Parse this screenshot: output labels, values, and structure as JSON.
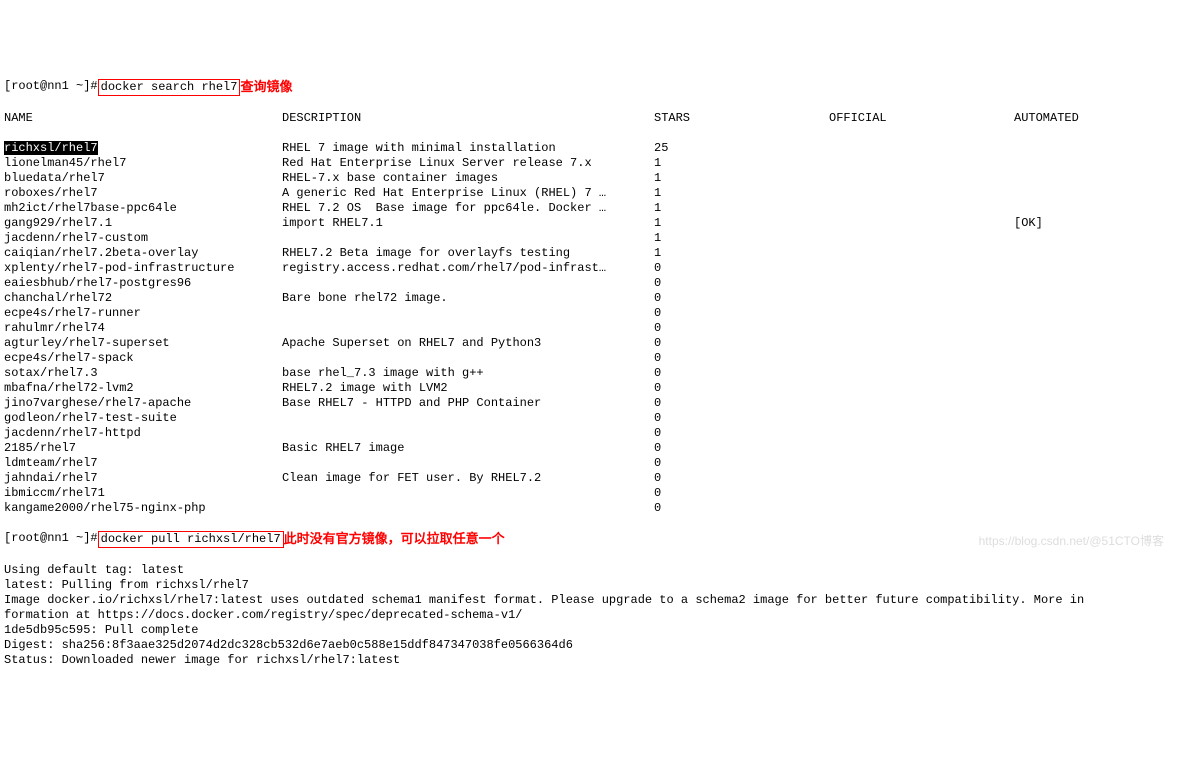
{
  "prompt1": "[root@nn1 ~]#",
  "command1": "docker search rhel7",
  "annotation1": "查询镜像",
  "headers": {
    "name": "NAME",
    "description": "DESCRIPTION",
    "stars": "STARS",
    "official": "OFFICIAL",
    "automated": "AUTOMATED"
  },
  "results": [
    {
      "name": "richxsl/rhel7",
      "desc": "RHEL 7 image with minimal installation",
      "stars": "25",
      "official": "",
      "auto": "",
      "highlight": true
    },
    {
      "name": "lionelman45/rhel7",
      "desc": "Red Hat Enterprise Linux Server release 7.x",
      "stars": "1",
      "official": "",
      "auto": ""
    },
    {
      "name": "bluedata/rhel7",
      "desc": "RHEL-7.x base container images",
      "stars": "1",
      "official": "",
      "auto": ""
    },
    {
      "name": "roboxes/rhel7",
      "desc": "A generic Red Hat Enterprise Linux (RHEL) 7 …",
      "stars": "1",
      "official": "",
      "auto": ""
    },
    {
      "name": "mh2ict/rhel7base-ppc64le",
      "desc": "RHEL 7.2 OS  Base image for ppc64le. Docker …",
      "stars": "1",
      "official": "",
      "auto": ""
    },
    {
      "name": "gang929/rhel7.1",
      "desc": "import RHEL7.1",
      "stars": "1",
      "official": "",
      "auto": "[OK]"
    },
    {
      "name": "jacdenn/rhel7-custom",
      "desc": "",
      "stars": "1",
      "official": "",
      "auto": ""
    },
    {
      "name": "caiqian/rhel7.2beta-overlay",
      "desc": "RHEL7.2 Beta image for overlayfs testing",
      "stars": "1",
      "official": "",
      "auto": ""
    },
    {
      "name": "xplenty/rhel7-pod-infrastructure",
      "desc": "registry.access.redhat.com/rhel7/pod-infrast…",
      "stars": "0",
      "official": "",
      "auto": ""
    },
    {
      "name": "eaiesbhub/rhel7-postgres96",
      "desc": "",
      "stars": "0",
      "official": "",
      "auto": ""
    },
    {
      "name": "chanchal/rhel72",
      "desc": "Bare bone rhel72 image.",
      "stars": "0",
      "official": "",
      "auto": ""
    },
    {
      "name": "ecpe4s/rhel7-runner",
      "desc": "",
      "stars": "0",
      "official": "",
      "auto": ""
    },
    {
      "name": "rahulmr/rhel74",
      "desc": "",
      "stars": "0",
      "official": "",
      "auto": ""
    },
    {
      "name": "agturley/rhel7-superset",
      "desc": "Apache Superset on RHEL7 and Python3",
      "stars": "0",
      "official": "",
      "auto": ""
    },
    {
      "name": "ecpe4s/rhel7-spack",
      "desc": "",
      "stars": "0",
      "official": "",
      "auto": ""
    },
    {
      "name": "sotax/rhel7.3",
      "desc": "base rhel_7.3 image with g++",
      "stars": "0",
      "official": "",
      "auto": ""
    },
    {
      "name": "mbafna/rhel72-lvm2",
      "desc": "RHEL7.2 image with LVM2",
      "stars": "0",
      "official": "",
      "auto": ""
    },
    {
      "name": "jino7varghese/rhel7-apache",
      "desc": "Base RHEL7 - HTTPD and PHP Container",
      "stars": "0",
      "official": "",
      "auto": ""
    },
    {
      "name": "godleon/rhel7-test-suite",
      "desc": "",
      "stars": "0",
      "official": "",
      "auto": ""
    },
    {
      "name": "jacdenn/rhel7-httpd",
      "desc": "",
      "stars": "0",
      "official": "",
      "auto": ""
    },
    {
      "name": "2185/rhel7",
      "desc": "Basic RHEL7 image",
      "stars": "0",
      "official": "",
      "auto": ""
    },
    {
      "name": "ldmteam/rhel7",
      "desc": "",
      "stars": "0",
      "official": "",
      "auto": ""
    },
    {
      "name": "jahndai/rhel7",
      "desc": "Clean image for FET user. By RHEL7.2",
      "stars": "0",
      "official": "",
      "auto": ""
    },
    {
      "name": "ibmiccm/rhel71",
      "desc": "",
      "stars": "0",
      "official": "",
      "auto": ""
    },
    {
      "name": "kangame2000/rhel75-nginx-php",
      "desc": "",
      "stars": "0",
      "official": "",
      "auto": ""
    }
  ],
  "prompt2": "[root@nn1 ~]#",
  "command2": "docker pull richxsl/rhel7",
  "annotation2": "此时没有官方镜像，可以拉取任意一个",
  "output_lines": [
    "Using default tag: latest",
    "latest: Pulling from richxsl/rhel7",
    "Image docker.io/richxsl/rhel7:latest uses outdated schema1 manifest format. Please upgrade to a schema2 image for better future compatibility. More in",
    "formation at https://docs.docker.com/registry/spec/deprecated-schema-v1/",
    "1de5db95c595: Pull complete",
    "Digest: sha256:8f3aae325d2074d2dc328cb532d6e7aeb0c588e15ddf847347038fe0566364d6",
    "Status: Downloaded newer image for richxsl/rhel7:latest"
  ],
  "watermark": "https://blog.csdn.net/@51CTO博客"
}
